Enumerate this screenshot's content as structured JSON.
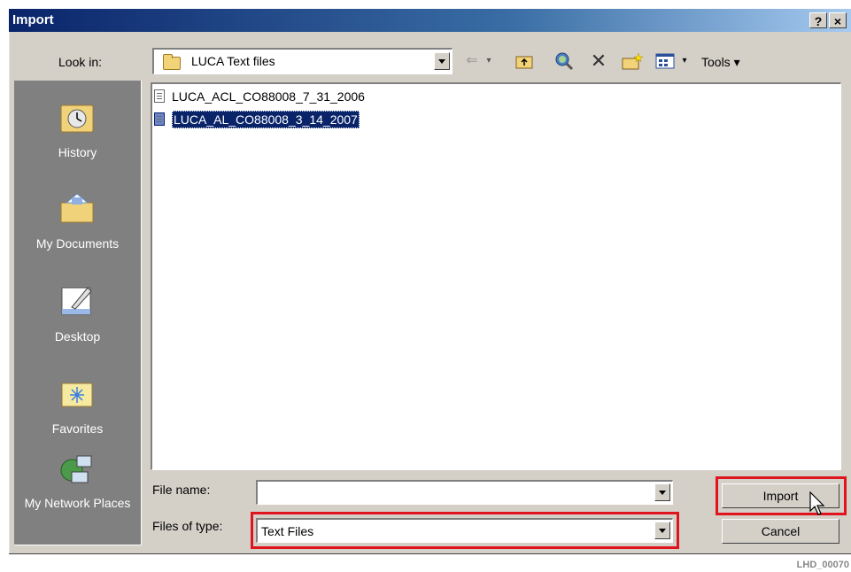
{
  "window": {
    "title": "Import",
    "help_button": "?",
    "close_button": "×"
  },
  "lookin": {
    "label": "Look in:",
    "value": "LUCA Text files"
  },
  "toolbar": {
    "tools_label": "Tools",
    "icons": [
      "back-icon",
      "up-folder-icon",
      "search-web-icon",
      "delete-icon",
      "new-folder-icon",
      "views-icon"
    ]
  },
  "places": [
    {
      "label": "History",
      "icon": "history-icon"
    },
    {
      "label": "My Documents",
      "icon": "my-documents-icon"
    },
    {
      "label": "Desktop",
      "icon": "desktop-icon"
    },
    {
      "label": "Favorites",
      "icon": "favorites-icon"
    },
    {
      "label": "My Network Places",
      "icon": "network-places-icon"
    }
  ],
  "files": [
    {
      "name": "LUCA_ACL_CO88008_7_31_2006",
      "selected": false
    },
    {
      "name": "LUCA_AL_CO88008_3_14_2007",
      "selected": true
    }
  ],
  "filename": {
    "label": "File name:",
    "value": ""
  },
  "filetype": {
    "label": "Files of type:",
    "value": "Text Files"
  },
  "buttons": {
    "import": "Import",
    "cancel": "Cancel"
  },
  "footer": {
    "code": "LHD_00070"
  },
  "colors": {
    "titlebar": "#0a246a",
    "highlight": "#e0141e",
    "dialog_bg": "#d4d0c8"
  }
}
